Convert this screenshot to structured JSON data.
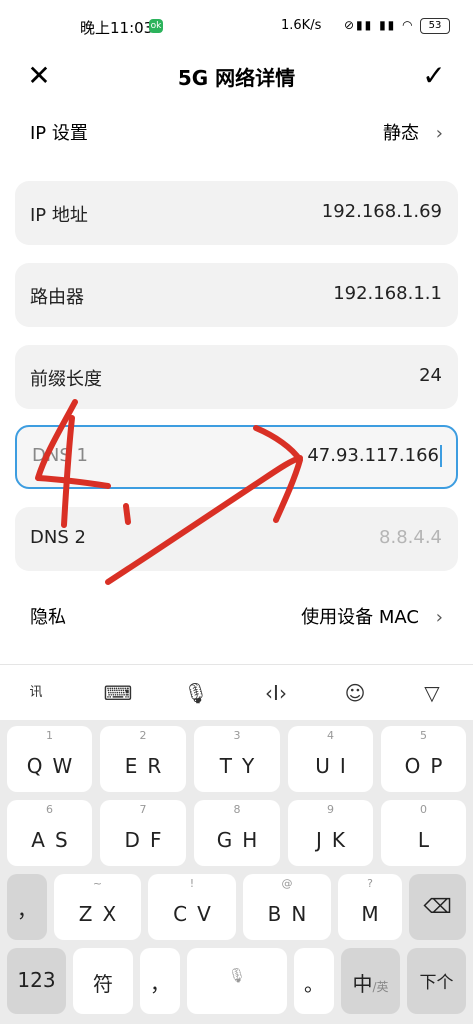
{
  "status_bar": {
    "time": "晚上11:03",
    "app_badge": "ok",
    "speed": "1.6K/s",
    "battery": "53"
  },
  "header": {
    "title": "5G 网络详情"
  },
  "ip_settings": {
    "label": "IP 设置",
    "value": "静态"
  },
  "fields": {
    "ip": {
      "label": "IP 地址",
      "value": "192.168.1.69"
    },
    "router": {
      "label": "路由器",
      "value": "192.168.1.1"
    },
    "prefix": {
      "label": "前缀长度",
      "value": "24"
    },
    "dns1": {
      "label": "DNS 1",
      "value": "47.93.117.166"
    },
    "dns2": {
      "label": "DNS 2",
      "value": "8.8.4.4"
    }
  },
  "privacy": {
    "label": "隐私",
    "value": "使用设备 MAC"
  },
  "annotation_color": "#d93025",
  "accent_color": "#3d9de0",
  "keyboard": {
    "row1": [
      {
        "sub": "1",
        "main": "QW"
      },
      {
        "sub": "2",
        "main": "ER"
      },
      {
        "sub": "3",
        "main": "TY"
      },
      {
        "sub": "4",
        "main": "UI"
      },
      {
        "sub": "5",
        "main": "OP"
      }
    ],
    "row2": [
      {
        "sub": "6",
        "main": "AS"
      },
      {
        "sub": "7",
        "main": "DF"
      },
      {
        "sub": "8",
        "main": "GH"
      },
      {
        "sub": "9",
        "main": "JK"
      },
      {
        "sub": "0",
        "main": "L"
      }
    ],
    "row3": [
      {
        "sub": "",
        "main": "，"
      },
      {
        "sub": "~",
        "main": "ZX"
      },
      {
        "sub": "!",
        "main": "CV"
      },
      {
        "sub": "@",
        "main": "BN"
      },
      {
        "sub": "?",
        "main": "M"
      }
    ],
    "bottom": {
      "num": "123",
      "symbol": "符",
      "comma": "，",
      "period": "。",
      "lang_main": "中",
      "lang_alt": "/英",
      "next": "下个"
    }
  }
}
